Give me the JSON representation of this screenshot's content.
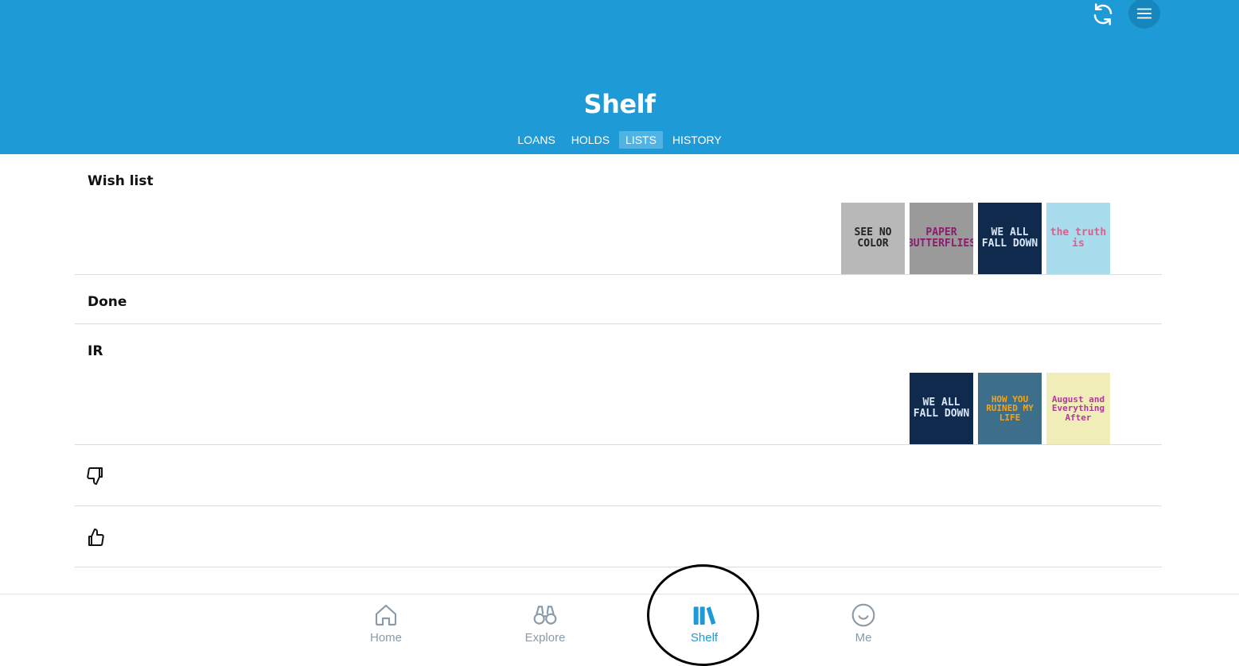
{
  "header": {
    "title": "Shelf",
    "sync_icon": "sync-icon",
    "menu_icon": "hamburger-menu-icon",
    "background": "#1e9bd7"
  },
  "tabs": [
    {
      "label": "LOANS",
      "active": false
    },
    {
      "label": "HOLDS",
      "active": false
    },
    {
      "label": "LISTS",
      "active": true
    },
    {
      "label": "HISTORY",
      "active": false
    }
  ],
  "lists": [
    {
      "name": "Wish list",
      "covers": [
        {
          "title": "SEE NO COLOR",
          "bg": "#b8b8b8",
          "fg": "#222222"
        },
        {
          "title": "PAPER BUTTERFLIES",
          "bg": "#9a9a9a",
          "fg": "#8a1c6e"
        },
        {
          "title": "WE ALL FALL DOWN",
          "bg": "#0f2a4d",
          "fg": "#d8e6f5"
        },
        {
          "title": "the truth is",
          "bg": "#a9dcec",
          "fg": "#e45a8a"
        }
      ]
    },
    {
      "name": "Done",
      "covers": []
    },
    {
      "name": "IR",
      "covers": [
        {
          "title": "WE ALL FALL DOWN",
          "bg": "#0f2a4d",
          "fg": "#d8e6f5"
        },
        {
          "title": "HOW YOU RUINED MY LIFE",
          "bg": "#3e6f8a",
          "fg": "#f2a51b"
        },
        {
          "title": "August and Everything After",
          "bg": "#f1edb8",
          "fg": "#b03a9c"
        }
      ]
    }
  ],
  "rating_rows": [
    {
      "icon": "thumbs-down-icon"
    },
    {
      "icon": "thumbs-up-icon"
    }
  ],
  "nav": [
    {
      "label": "Home",
      "icon": "home-icon",
      "active": false
    },
    {
      "label": "Explore",
      "icon": "binoculars-icon",
      "active": false
    },
    {
      "label": "Shelf",
      "icon": "books-icon",
      "active": true
    },
    {
      "label": "Me",
      "icon": "smiley-icon",
      "active": false
    }
  ]
}
